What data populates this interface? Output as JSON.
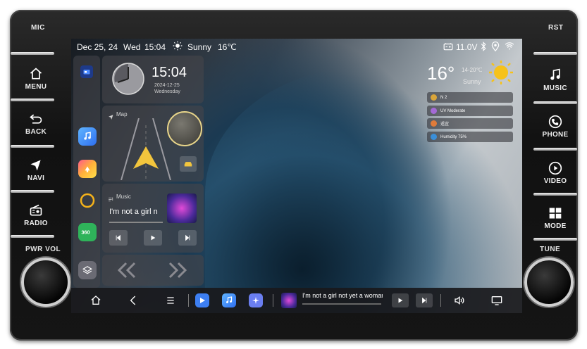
{
  "hardware": {
    "mic_label": "MIC",
    "rst_label": "RST",
    "pwr_vol_label": "PWR VOL",
    "tune_label": "TUNE",
    "left_buttons": [
      {
        "label": "MENU",
        "icon": "home-icon"
      },
      {
        "label": "BACK",
        "icon": "back-icon"
      },
      {
        "label": "NAVI",
        "icon": "navigation-icon"
      },
      {
        "label": "RADIO",
        "icon": "radio-icon"
      }
    ],
    "right_buttons": [
      {
        "label": "MUSIC",
        "icon": "music-note-icon"
      },
      {
        "label": "PHONE",
        "icon": "phone-icon"
      },
      {
        "label": "VIDEO",
        "icon": "play-circle-icon"
      },
      {
        "label": "MODE",
        "icon": "grid-icon"
      }
    ]
  },
  "status_bar": {
    "date": "Dec 25, 24",
    "weekday": "Wed",
    "time": "15:04",
    "weather_icon": "sun-icon",
    "weather": "Sunny",
    "temperature": "16℃",
    "voltage": "11.0V"
  },
  "clock_widget": {
    "time": "15:04",
    "date": "2024-12-25",
    "weekday": "Wednesday"
  },
  "map_widget": {
    "title": "Map"
  },
  "music_widget": {
    "title": "Music",
    "track": "I'm not a girl n"
  },
  "weather_widget": {
    "temperature": "16°",
    "range": "14-20℃",
    "condition": "Sunny",
    "items": [
      {
        "text": "N 2",
        "color": "#d9a53a"
      },
      {
        "text": "UV Moderate",
        "color": "#a46ad6"
      },
      {
        "text": "适宜",
        "color": "#e07b3a"
      },
      {
        "text": "Humidity 75%",
        "color": "#3a8fd9"
      }
    ]
  },
  "dock": {
    "now_playing": "I'm not a girl not yet a woman"
  },
  "colors": {
    "sun": "#f6c21a",
    "accent_blue": "#3d7ff2"
  }
}
